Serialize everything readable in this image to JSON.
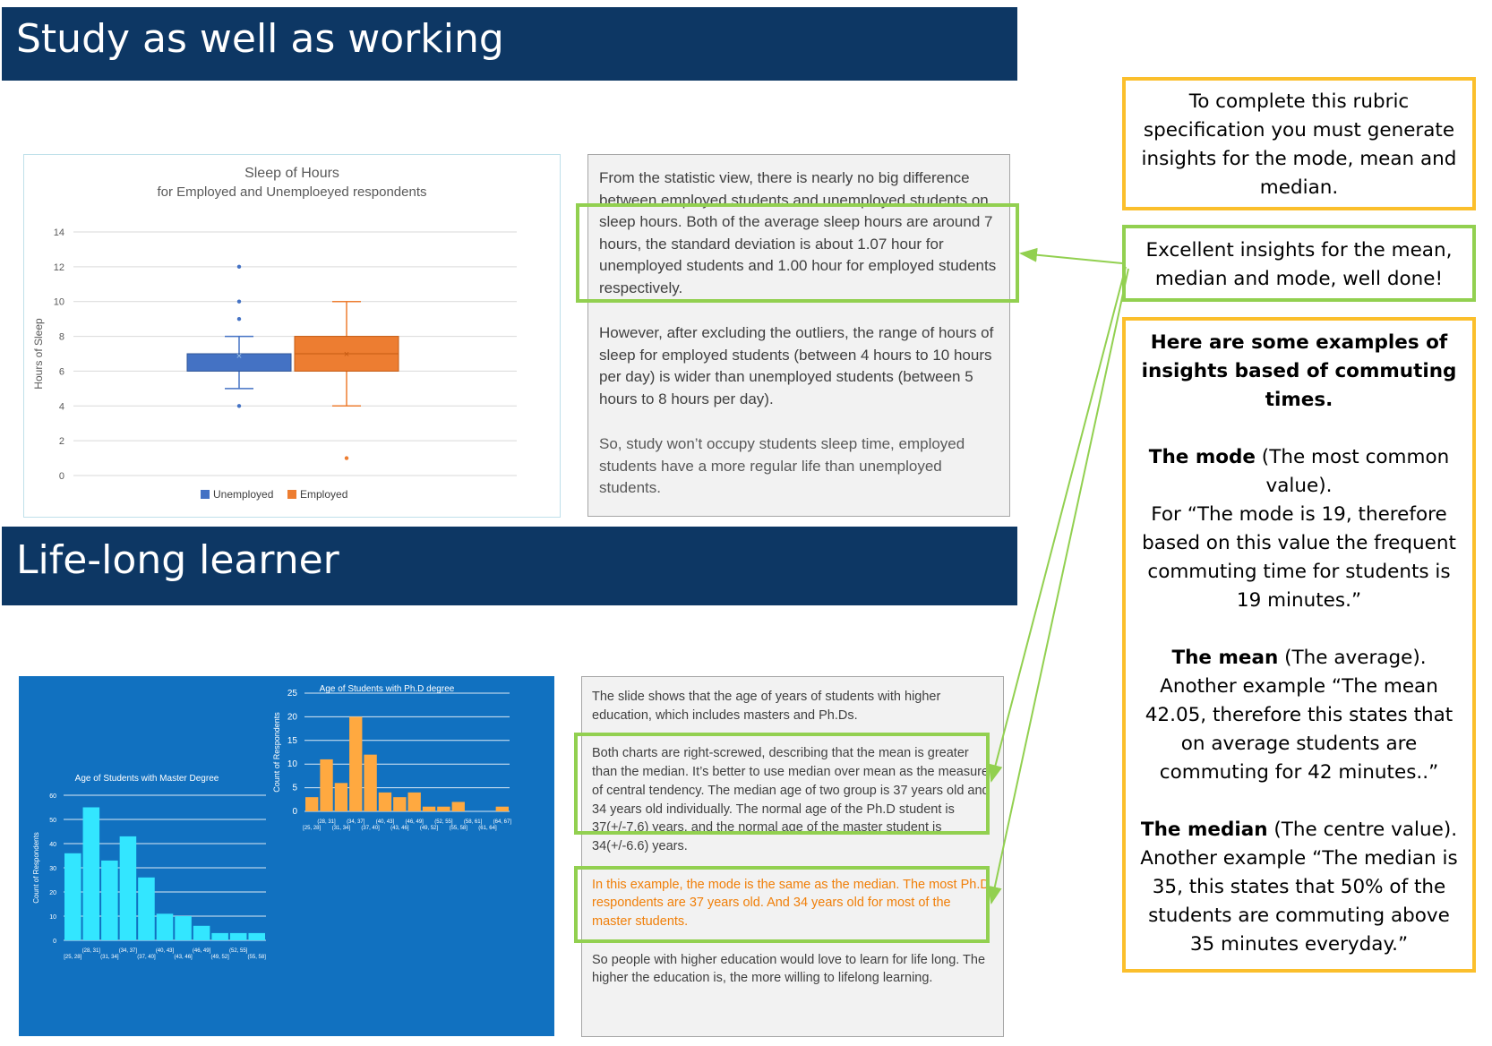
{
  "sections": {
    "study": {
      "title": "Study as well as working"
    },
    "lifelong": {
      "title": "Life-long learner"
    }
  },
  "sleep_text": {
    "p1": "From the statistic view, there is nearly no big difference between employed students and unemployed students on sleep hours.  Both of the average sleep hours are around 7 hours, the standard deviation is about 1.07 hour for unemployed students and 1.00 hour for employed students respectively.",
    "p2": "However, after excluding the outliers, the range of hours of sleep for employed students (between 4 hours to 10 hours per day) is wider than unemployed students (between 5 hours to 8 hours per day).",
    "p3": "So, study won’t occupy students sleep time, employed students have a more regular life than unemployed students."
  },
  "age_text": {
    "p1": "The slide shows that the age of years of students with higher education, which includes masters and Ph.Ds.",
    "p2": "Both charts are right-screwed, describing that the mean is greater than the median. It’s better to use median over mean as the measure of central tendency. The median age of two group is 37 years old and 34 years old individually. The normal age of the Ph.D student is 37(+/-7.6) years, and the normal age of the master student is 34(+/-6.6) years.",
    "p3": "In this example, the mode is the same as the median. The most Ph.D. respondents are 37 years old. And 34 years old for most of the master students.",
    "p4": "So people with higher education would love to learn for life long. The higher the education is, the more  willing to lifelong learning."
  },
  "callouts": {
    "rubric": "To complete this rubric specification you must generate insights for the mode, mean and median.",
    "praise": "Excellent insights for the mean, median and mode, well done!",
    "examples_heading": "Here are some examples of insights based of commuting times.",
    "mode_label": "The mode",
    "mode_desc": " (The most common value).",
    "mode_example": "For “The mode is 19, therefore based on this value the frequent commuting time for students is 19 minutes.”",
    "mean_label": "The mean",
    "mean_desc": " (The average).",
    "mean_example": "Another example “The mean 42.05, therefore this states that on average students are commuting for 42 minutes..”",
    "median_label": "The median",
    "median_desc": " (The centre value).",
    "median_example": "Another example “The median is 35, this states that 50% of the students are commuting above 35 minutes everyday.”"
  },
  "colors": {
    "banner": "#0d3764",
    "highlight_green": "#92d050",
    "callout_yellow": "#fbbf2c",
    "unemployed": "#4472c4",
    "employed": "#ed7d31",
    "master_bar": "#33e6ff",
    "phd_bar": "#ffa940",
    "chart_panel": "#1171c0"
  },
  "chart_data": [
    {
      "type": "box",
      "title": "Sleep of Hours",
      "subtitle": "for Employed and Unemploeyed respondents",
      "ylabel": "Hours of Sleep",
      "ylim": [
        0,
        14
      ],
      "yticks": [
        "0",
        "2",
        "4",
        "6",
        "8",
        "10",
        "12",
        "14"
      ],
      "grid": true,
      "legend_position": "bottom",
      "series": [
        {
          "name": "Unemployed",
          "min": 5,
          "q1": 6,
          "median": 7,
          "mean": 6.9,
          "q3": 7,
          "max": 8,
          "outliers": [
            4,
            9,
            10,
            12
          ]
        },
        {
          "name": "Employed",
          "min": 4,
          "q1": 6,
          "median": 7,
          "mean": 7,
          "q3": 8,
          "max": 10,
          "outliers": [
            1
          ]
        }
      ]
    },
    {
      "type": "bar",
      "title": "Age of Students with Master Degree",
      "ylabel": "Count of Respondents",
      "ylim": [
        0,
        60
      ],
      "yticks": [
        "0",
        "10",
        "20",
        "30",
        "40",
        "50",
        "60"
      ],
      "categories": [
        "[25, 28]",
        "(28, 31]",
        "(31, 34]",
        "(34, 37]",
        "(37, 40]",
        "(40, 43]",
        "(43, 46]",
        "(46, 49]",
        "(49, 52]",
        "(52, 55]",
        "(55, 58]"
      ],
      "values": [
        36,
        55,
        33,
        43,
        26,
        11,
        10,
        6,
        3,
        3,
        3
      ]
    },
    {
      "type": "bar",
      "title": "Age of Students with Ph.D degree",
      "ylabel": "Count of Respondents",
      "ylim": [
        0,
        25
      ],
      "yticks": [
        "0",
        "5",
        "10",
        "15",
        "20",
        "25"
      ],
      "categories": [
        "[25, 28]",
        "(28, 31]",
        "(31, 34]",
        "(34, 37]",
        "(37, 40]",
        "(40, 43]",
        "(43, 46]",
        "(46, 49]",
        "(49, 52]",
        "(52, 55]",
        "(55, 58]",
        "(58, 61]",
        "(61, 64]",
        "(64, 67]"
      ],
      "values": [
        3,
        11,
        6,
        20,
        12,
        4,
        3,
        4,
        1,
        1,
        2,
        0,
        0,
        1
      ]
    }
  ]
}
